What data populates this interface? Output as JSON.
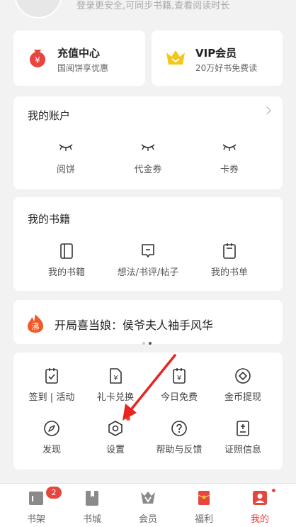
{
  "profile": {
    "login_hint": "登录更安全,可同步书籍,查看阅读时长"
  },
  "promos": [
    {
      "title": "充值中心",
      "subtitle": "国阅饼享优惠",
      "icon": "money-bag-icon"
    },
    {
      "title": "VIP会员",
      "subtitle": "20万好书免费读",
      "icon": "crown-icon"
    }
  ],
  "account": {
    "title": "我的账户",
    "items": [
      {
        "label": "阅饼",
        "icon": "closed-eye-icon"
      },
      {
        "label": "代金券",
        "icon": "closed-eye-icon"
      },
      {
        "label": "卡券",
        "icon": "closed-eye-icon"
      }
    ]
  },
  "books": {
    "title": "我的书籍",
    "items": [
      {
        "label": "我的书籍",
        "icon": "book-icon"
      },
      {
        "label": "想法/书评/帖子",
        "icon": "comment-icon"
      },
      {
        "label": "我的书单",
        "icon": "booklist-icon"
      }
    ]
  },
  "hot": {
    "badge": "沸",
    "text": "开局喜当娘：侯爷夫人袖手风华"
  },
  "tools": [
    {
      "label": "签到 | 活动",
      "icon": "checkin-icon"
    },
    {
      "label": "礼卡兑换",
      "icon": "gift-card-icon"
    },
    {
      "label": "今日免费",
      "icon": "free-today-icon"
    },
    {
      "label": "金币提现",
      "icon": "coin-withdraw-icon"
    },
    {
      "label": "发现",
      "icon": "compass-icon"
    },
    {
      "label": "设置",
      "icon": "settings-hexagon-icon"
    },
    {
      "label": "帮助与反馈",
      "icon": "help-icon"
    },
    {
      "label": "证照信息",
      "icon": "license-icon"
    }
  ],
  "tabs": [
    {
      "label": "书架",
      "badge": "2"
    },
    {
      "label": "书城"
    },
    {
      "label": "会员"
    },
    {
      "label": "福利"
    },
    {
      "label": "我的"
    }
  ],
  "colors": {
    "accent": "#e8453c",
    "background": "#f2f2f2",
    "card": "#ffffff",
    "icon": "#333333",
    "vip_gold": "#f5c518"
  }
}
